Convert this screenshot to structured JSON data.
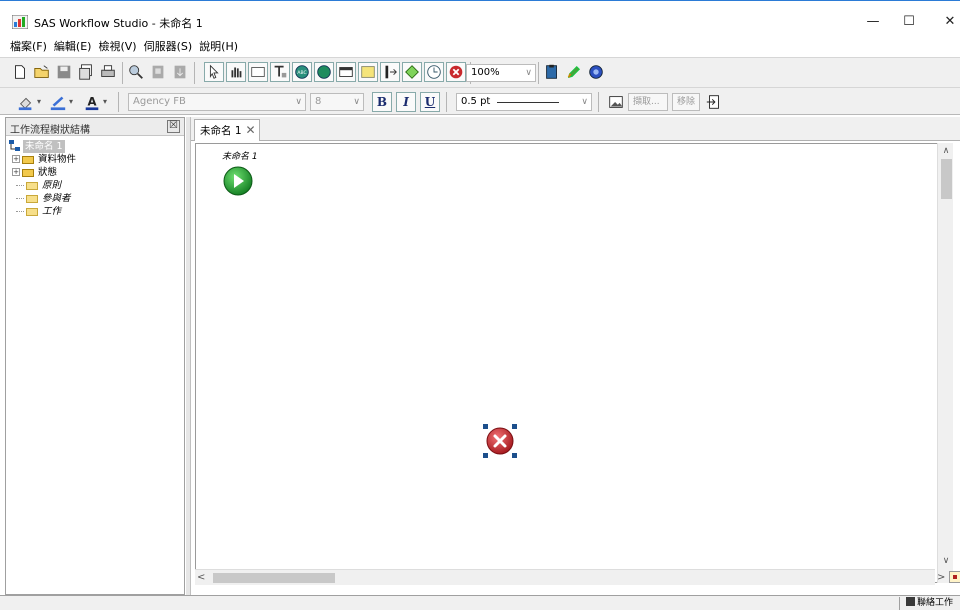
{
  "window": {
    "title": "SAS Workflow Studio - 未命名 1",
    "minimize": "—",
    "maximize": "☐",
    "close": "✕"
  },
  "menu": [
    "檔案(F)",
    "編輯(E)",
    "檢視(V)",
    "伺服器(S)",
    "說明(H)"
  ],
  "toolbar": {
    "zoom": "100%",
    "font": "Agency FB",
    "font_size": "8",
    "bold": "B",
    "italic": "I",
    "underline": "U",
    "line_width": "0.5 pt",
    "retrieve": "擷取...",
    "remove": "移除"
  },
  "tree_pane": {
    "title": "工作流程樹狀結構",
    "close": "☒",
    "root": "未命名 1",
    "items": [
      {
        "label": "資料物件",
        "expandable": true,
        "italic": false
      },
      {
        "label": "狀態",
        "expandable": true,
        "italic": false
      },
      {
        "label": "原則",
        "expandable": false,
        "italic": true
      },
      {
        "label": "參與者",
        "expandable": false,
        "italic": true
      },
      {
        "label": "工作",
        "expandable": false,
        "italic": true
      }
    ]
  },
  "editor": {
    "tab_label": "未命名 1",
    "tab_close": "✕",
    "canvas_title": "未命名 1"
  },
  "status": {
    "text": "聯絡工作"
  },
  "colors": {
    "start_green": "#1e9a2e",
    "end_red": "#c8282c",
    "selection": "#1c4f8c",
    "tree_root_bg": "#c0c0c0"
  }
}
